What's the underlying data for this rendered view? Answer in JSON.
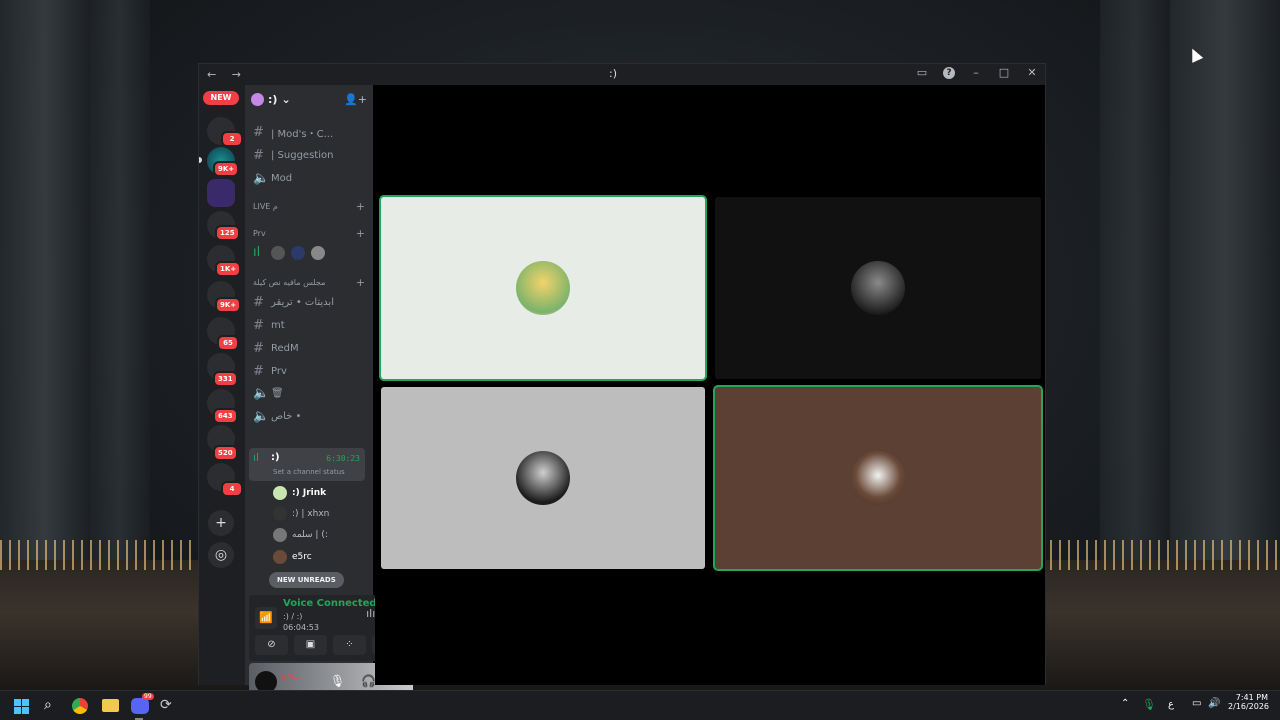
{
  "window": {
    "nav": "← →",
    "title": ":)",
    "controls": [
      "inbox-icon",
      "help-icon",
      "minimize-icon",
      "maximize-icon",
      "close-icon"
    ],
    "help_glyph": "?"
  },
  "rail": {
    "new_label": "NEW",
    "badges": [
      "2",
      "9K+",
      "125",
      "1K+",
      "9K+",
      "65",
      "331",
      "643",
      "520",
      "4"
    ]
  },
  "sidebar": {
    "guild_name": ":)",
    "channels": [
      {
        "name": "| Mod's・C...",
        "type": "text"
      },
      {
        "name": "| Suggestion",
        "type": "text"
      },
      {
        "name": "Mod",
        "type": "voice"
      }
    ],
    "categories": {
      "live": "LIVE م",
      "prv": "Prv",
      "arabic": "مجلس مافيه نص كيلة"
    },
    "channels2": [
      {
        "name": "ابديتات • تريقر",
        "type": "text"
      },
      {
        "name": "mt",
        "type": "text"
      },
      {
        "name": "RedM",
        "type": "text"
      },
      {
        "name": "Prv",
        "type": "text"
      },
      {
        "name": "🗑",
        "type": "voice"
      },
      {
        "name": "خاص •",
        "type": "voice"
      }
    ],
    "active_voice": {
      "name": ":)",
      "time": "6:30:23",
      "status": "Set a channel status"
    },
    "members": [
      ":) Jrink",
      ":) | xhxn",
      "سلمه | (:",
      "e5rc"
    ],
    "new_unreads": "NEW UNREADS"
  },
  "voice_panel": {
    "title": "Voice Connected",
    "channel": ":) / :)",
    "elapsed": "06:04:53"
  },
  "user_panel": {
    "name": "Srv..."
  },
  "colors": {
    "accent_green": "#23a55a",
    "badge_red": "#f23f43",
    "tile1": "#e8ece6",
    "tile2": "#111111",
    "tile3": "#bdbdbd",
    "tile4": "#5c4033"
  },
  "taskbar": {
    "time": "7:41 PM",
    "date": "2/16/2026",
    "lang": "ع",
    "notif_badge": "99"
  }
}
